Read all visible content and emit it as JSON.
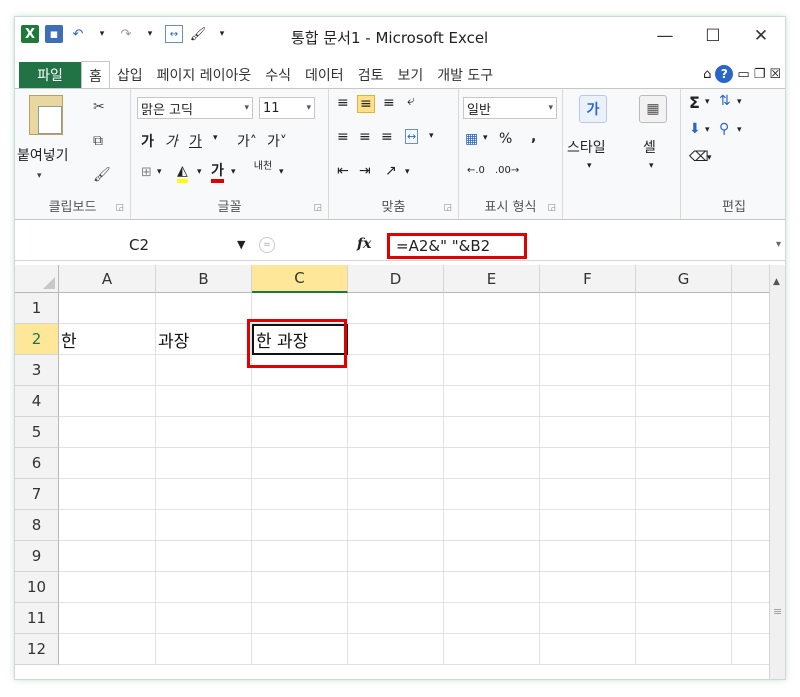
{
  "window": {
    "title": "통합 문서1 - Microsoft Excel",
    "minimize": "—",
    "maximize": "☐",
    "close": "✕"
  },
  "tabs": [
    {
      "label": "파일"
    },
    {
      "label": "홈"
    },
    {
      "label": "삽입"
    },
    {
      "label": "페이지 레이아웃"
    },
    {
      "label": "수식"
    },
    {
      "label": "데이터"
    },
    {
      "label": "검토"
    },
    {
      "label": "보기"
    },
    {
      "label": "개발 도구"
    }
  ],
  "ribbon": {
    "clipboard": {
      "paste_label": "붙여넣기",
      "group_label": "클립보드"
    },
    "font": {
      "font_name": "맑은 고딕",
      "font_size": "11",
      "bold": "가",
      "italic": "가",
      "underline": "가",
      "grow": "가˄",
      "shrink": "가˅",
      "font_color": "가",
      "phonetic": "내천",
      "group_label": "글꼴"
    },
    "alignment": {
      "group_label": "맞춤"
    },
    "number": {
      "format": "일반",
      "percent": "%",
      "comma": ",",
      "group_label": "표시 형식"
    },
    "styles": {
      "label": "스타일"
    },
    "cells": {
      "label": "셀"
    },
    "editing": {
      "sum": "Σ",
      "group_label": "편집"
    }
  },
  "formula_bar": {
    "name_box": "C2",
    "fx": "fx",
    "formula": "=A2&\" \"&B2"
  },
  "grid": {
    "columns": [
      "A",
      "B",
      "C",
      "D",
      "E",
      "F",
      "G"
    ],
    "rows": [
      "1",
      "2",
      "3",
      "4",
      "5",
      "6",
      "7",
      "8",
      "9",
      "10",
      "11",
      "12"
    ],
    "cells": {
      "A2": "한",
      "B2": "과장",
      "C2": "한 과장"
    },
    "active_cell": "C2"
  },
  "colors": {
    "excel_green": "#217346",
    "highlight_red": "#e00000",
    "selected_header": "#ffe79a"
  }
}
